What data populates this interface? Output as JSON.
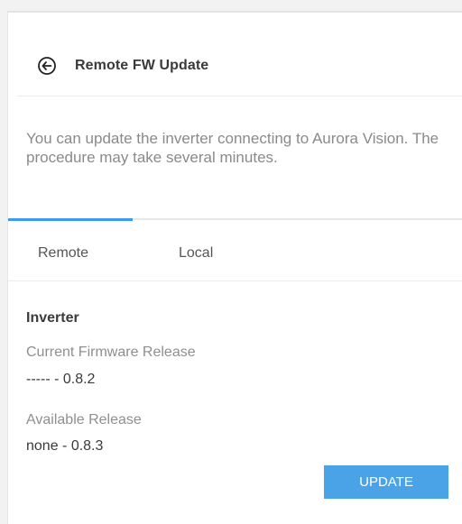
{
  "header": {
    "title": "Remote FW Update",
    "back_icon": "arrow-left-circle-icon"
  },
  "description": "You can update the inverter connecting to Aurora Vision. The procedure may take several minutes.",
  "tabs": [
    {
      "label": "Remote",
      "active": true
    },
    {
      "label": "Local",
      "active": false
    }
  ],
  "inverter": {
    "section_title": "Inverter",
    "current_label": "Current Firmware Release",
    "current_value": "----- - 0.8.2",
    "available_label": "Available Release",
    "available_value": "none - 0.8.3"
  },
  "actions": {
    "update_label": "UPDATE"
  },
  "colors": {
    "accent": "#3d9be9",
    "button": "#4aa3e6",
    "text_primary": "#3a3a3a",
    "text_muted": "#8a8a8a"
  }
}
